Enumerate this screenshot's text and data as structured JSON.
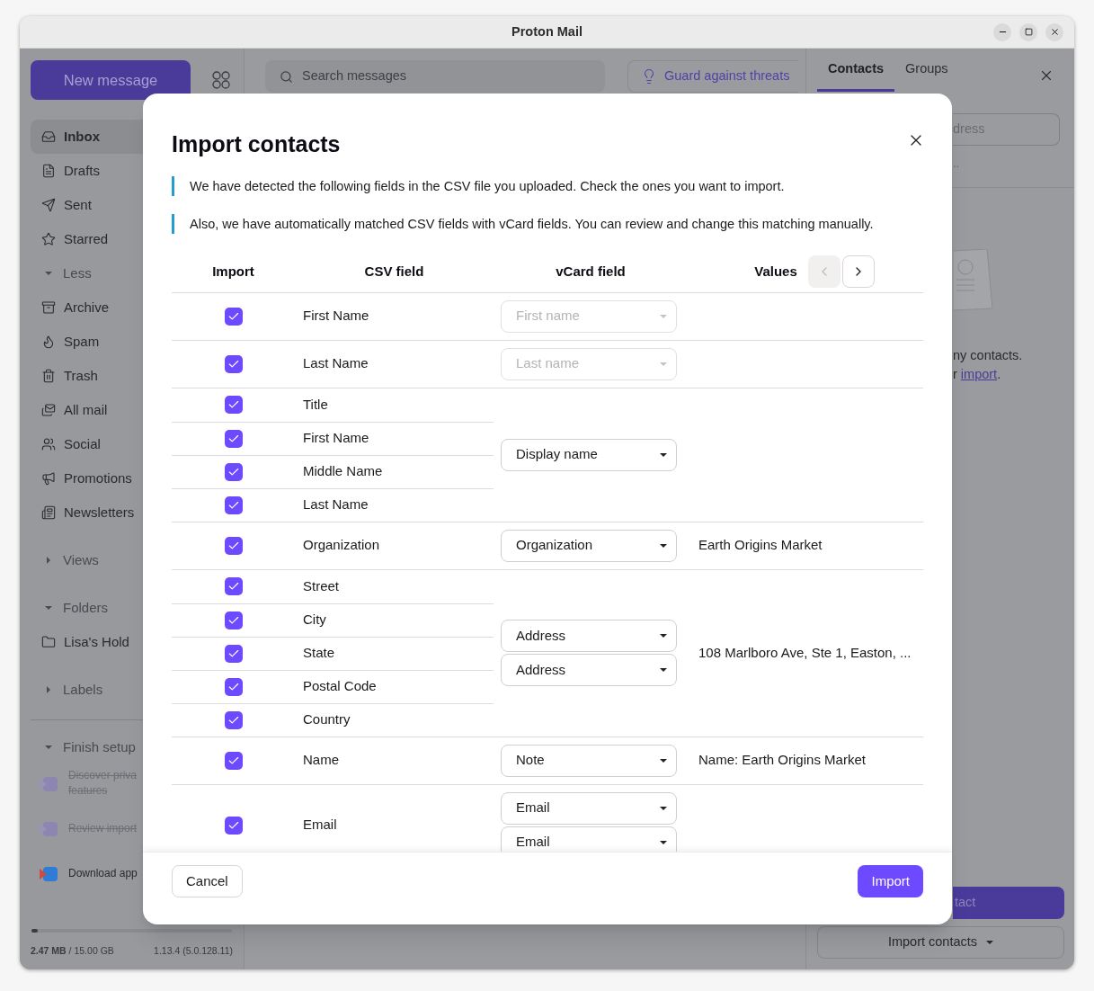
{
  "window": {
    "title": "Proton Mail"
  },
  "sidebar": {
    "new_message": "New message",
    "items": [
      {
        "kind": "nav",
        "label": "Inbox",
        "selected": true
      },
      {
        "kind": "nav",
        "label": "Drafts",
        "selected": false
      },
      {
        "kind": "nav",
        "label": "Sent",
        "selected": false
      },
      {
        "kind": "nav",
        "label": "Starred",
        "selected": false
      },
      {
        "kind": "toggle",
        "label": "Less",
        "expanded": true
      },
      {
        "kind": "nav",
        "label": "Archive",
        "selected": false
      },
      {
        "kind": "nav",
        "label": "Spam",
        "selected": false
      },
      {
        "kind": "nav",
        "label": "Trash",
        "selected": false
      },
      {
        "kind": "nav",
        "label": "All mail",
        "selected": false
      },
      {
        "kind": "nav",
        "label": "Social",
        "selected": false
      },
      {
        "kind": "nav",
        "label": "Promotions",
        "selected": false
      },
      {
        "kind": "nav",
        "label": "Newsletters",
        "selected": false
      },
      {
        "kind": "section",
        "label": "Views",
        "expanded": false
      },
      {
        "kind": "section",
        "label": "Folders",
        "expanded": true
      },
      {
        "kind": "folder",
        "label": "Lisa's Hold",
        "selected": false
      },
      {
        "kind": "section",
        "label": "Labels",
        "expanded": false
      }
    ],
    "setup": {
      "label": "Finish setup",
      "expanded": true,
      "tasks": [
        {
          "lines": [
            "Discover priva",
            "features"
          ],
          "done": true
        },
        {
          "lines": [
            "Review import"
          ],
          "done": true
        },
        {
          "lines": [
            "Download app"
          ],
          "done": false
        }
      ]
    },
    "storage": {
      "level": 0.02,
      "usage": "**2.47 MB** / 15.00 GB",
      "version": "1.13.4 (5.0.128.11)"
    }
  },
  "toolbar": {
    "search": {
      "placeholder": "Search messages"
    },
    "guard_button": "Guard against threats"
  },
  "contacts_panel": {
    "tabs": [
      {
        "label": "Contacts",
        "selected": true
      },
      {
        "label": "Groups",
        "selected": false
      }
    ],
    "search": {
      "placeholder": "dress"
    },
    "hint": "..",
    "empty_text": {
      "line_1": "ny contacts.",
      "line_2_before": "r",
      "link": "import",
      "line_2_after": "."
    },
    "add_button": "tact",
    "import_button": "Import contacts"
  },
  "modal": {
    "title": "Import contacts",
    "notes": [
      "We have detected the following fields in the CSV file you uploaded. Check the ones you want to import.",
      "Also, we have automatically matched CSV fields with vCard fields. You can review and change this matching manually."
    ],
    "columns": [
      "Import",
      "CSV field",
      "vCard field",
      "Values"
    ],
    "prev_disabled": true,
    "next_disabled": false,
    "groups": [
      {
        "fields": [
          {
            "name": "First Name",
            "checked": true
          }
        ],
        "vcard": [
          {
            "placeholder": "First name"
          }
        ]
      },
      {
        "fields": [
          {
            "name": "Last Name",
            "checked": true
          }
        ],
        "vcard": [
          {
            "placeholder": "Last name"
          }
        ]
      },
      {
        "fields": [
          {
            "name": "Title",
            "checked": true
          },
          {
            "name": "First Name",
            "checked": true
          },
          {
            "name": "Middle Name",
            "checked": true
          },
          {
            "name": "Last Name",
            "checked": true
          }
        ],
        "vcard": [
          {
            "value": "Display name"
          }
        ]
      },
      {
        "fields": [
          {
            "name": "Organization",
            "checked": true
          }
        ],
        "vcard": [
          {
            "value": "Organization"
          }
        ],
        "value": "Earth Origins Market"
      },
      {
        "fields": [
          {
            "name": "Street",
            "checked": true
          },
          {
            "name": "City",
            "checked": true
          },
          {
            "name": "State",
            "checked": true
          },
          {
            "name": "Postal Code",
            "checked": true
          },
          {
            "name": "Country",
            "checked": true
          }
        ],
        "vcard": [
          {
            "value": "Address"
          },
          {
            "value": "Address"
          }
        ],
        "value": "108 Marlboro Ave, Ste 1, Easton, ..."
      },
      {
        "fields": [
          {
            "name": "Name",
            "checked": true
          }
        ],
        "vcard": [
          {
            "value": "Note"
          }
        ],
        "value": "Name: Earth Origins Market"
      },
      {
        "fields": [
          {
            "name": "Email",
            "checked": true
          }
        ],
        "vcard": [
          {
            "value": "Email"
          },
          {
            "value": "Email"
          }
        ]
      }
    ],
    "cancel": "Cancel",
    "import": "Import"
  }
}
